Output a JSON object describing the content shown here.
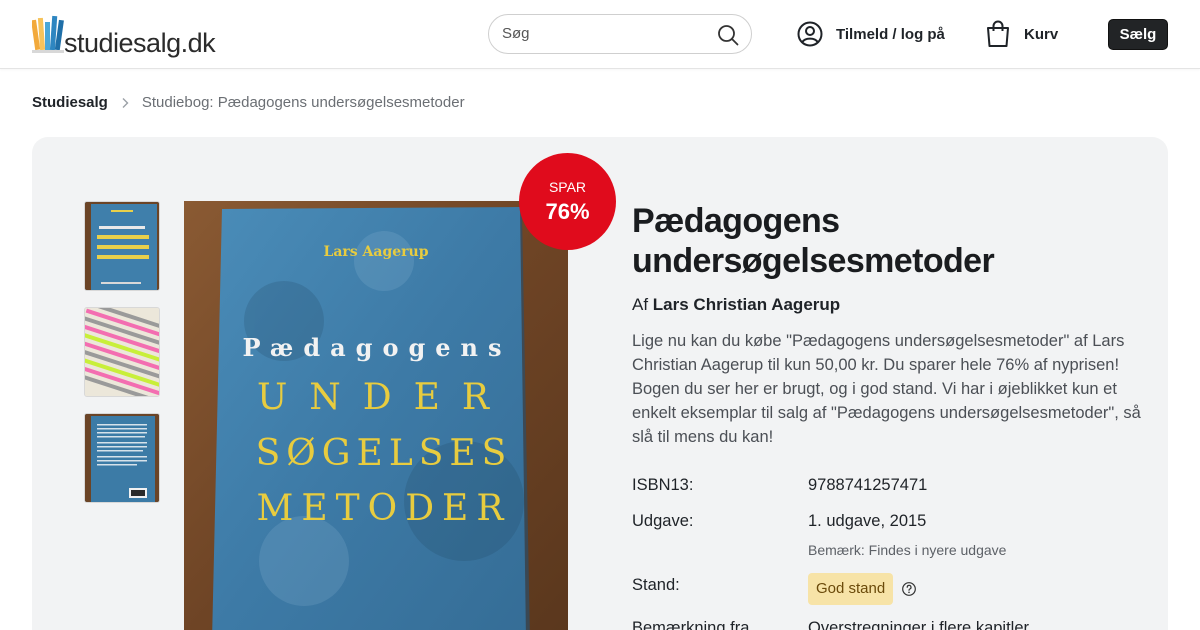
{
  "header": {
    "logo_text_main": "studiesalg",
    "logo_text_tld": ".dk",
    "search_placeholder": "Søg",
    "login_label": "Tilmeld / log på",
    "cart_label": "Kurv",
    "sell_label": "Sælg"
  },
  "breadcrumb": {
    "home": "Studiesalg",
    "current": "Studiebog: Pædagogens undersøgelsesmetoder"
  },
  "book_cover": {
    "author": "Lars Aagerup",
    "line1": "Pædagogens",
    "line2": "UNDER",
    "line3": "SØGELSES",
    "line4": "METODER"
  },
  "discount": {
    "label": "SPAR",
    "percent": "76%"
  },
  "product": {
    "title_line1": "Pædagogens",
    "title_line2": "undersøgelsesmetoder",
    "by_label": "Af",
    "author": "Lars Christian Aagerup",
    "description": "Lige nu kan du købe \"Pædagogens undersøgelsesmetoder\" af Lars Christian Aagerup til kun 50,00 kr. Du sparer hele 76% af nyprisen! Bogen du ser her er brugt, og i god stand. Vi har i øjeblikket kun et enkelt eksemplar til salg af \"Pædagogens undersøgelsesmetoder\", så slå til mens du kan!",
    "isbn_label": "ISBN13:",
    "isbn_value": "9788741257471",
    "edition_label": "Udgave:",
    "edition_value": "1. udgave, 2015",
    "edition_note": "Bemærk: Findes i nyere udgave",
    "condition_label": "Stand:",
    "condition_value": "God stand",
    "remark_label": "Bemærkning fra",
    "remark_value": "Overstregninger i flere kapitler"
  },
  "colors": {
    "accent_red": "#e00b1c",
    "badge_bg": "#f7e3a7",
    "sell_button": "#222426",
    "card_bg": "#f2f3f4"
  },
  "icons": [
    "search-icon",
    "user-circle-icon",
    "shopping-bag-icon",
    "chevron-right-icon",
    "question-circle-icon"
  ]
}
